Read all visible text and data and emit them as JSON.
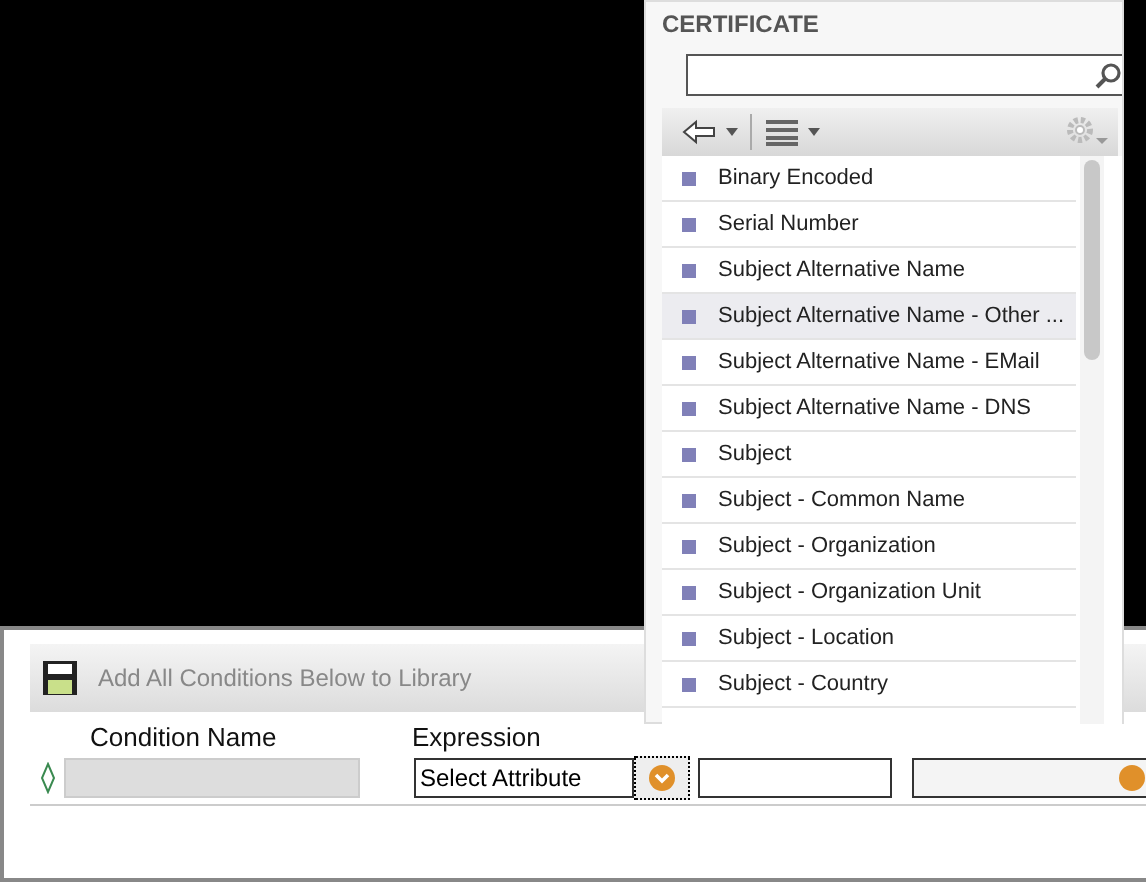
{
  "popup": {
    "title": "CERTIFICATE",
    "items": [
      {
        "label": "Binary Encoded",
        "selected": false
      },
      {
        "label": "Serial Number",
        "selected": false
      },
      {
        "label": "Subject Alternative Name",
        "selected": false
      },
      {
        "label": "Subject Alternative Name - Other ...",
        "selected": true
      },
      {
        "label": "Subject Alternative Name - EMail",
        "selected": false
      },
      {
        "label": "Subject Alternative Name - DNS",
        "selected": false
      },
      {
        "label": "Subject",
        "selected": false
      },
      {
        "label": "Subject - Common Name",
        "selected": false
      },
      {
        "label": "Subject - Organization",
        "selected": false
      },
      {
        "label": "Subject - Organization Unit",
        "selected": false
      },
      {
        "label": "Subject - Location",
        "selected": false
      },
      {
        "label": "Subject - Country",
        "selected": false
      }
    ]
  },
  "toolbar": {
    "label": "Add All Conditions Below to Library"
  },
  "columns": [
    "Condition Name",
    "Expression"
  ],
  "condition": {
    "attribute": "Select Attribute"
  }
}
